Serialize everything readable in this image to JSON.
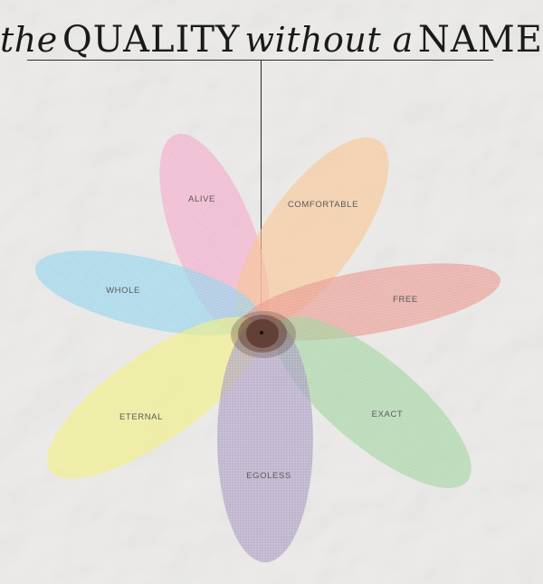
{
  "title": {
    "word_1": "the",
    "word_2": "QUALITY",
    "word_3": "without a",
    "word_4": "NAME"
  },
  "petals": [
    {
      "label": "ALIVE",
      "color": "#f4a7c8"
    },
    {
      "label": "COMFORTABLE",
      "color": "#f9c48f"
    },
    {
      "label": "WHOLE",
      "color": "#8fd3ee"
    },
    {
      "label": "FREE",
      "color": "#e9948a"
    },
    {
      "label": "ETERNAL",
      "color": "#f2ef7c"
    },
    {
      "label": "EXACT",
      "color": "#9fd49c"
    },
    {
      "label": "EGOLESS",
      "color": "#a89ac2"
    }
  ],
  "center_color": "#5e3c32"
}
